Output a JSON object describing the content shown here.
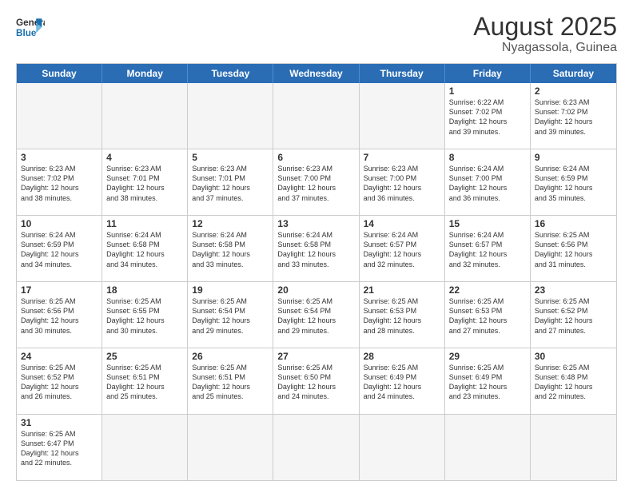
{
  "header": {
    "logo_general": "General",
    "logo_blue": "Blue",
    "month_year": "August 2025",
    "location": "Nyagassola, Guinea"
  },
  "days_of_week": [
    "Sunday",
    "Monday",
    "Tuesday",
    "Wednesday",
    "Thursday",
    "Friday",
    "Saturday"
  ],
  "weeks": [
    [
      {
        "day": "",
        "info": ""
      },
      {
        "day": "",
        "info": ""
      },
      {
        "day": "",
        "info": ""
      },
      {
        "day": "",
        "info": ""
      },
      {
        "day": "",
        "info": ""
      },
      {
        "day": "1",
        "info": "Sunrise: 6:22 AM\nSunset: 7:02 PM\nDaylight: 12 hours\nand 39 minutes."
      },
      {
        "day": "2",
        "info": "Sunrise: 6:23 AM\nSunset: 7:02 PM\nDaylight: 12 hours\nand 39 minutes."
      }
    ],
    [
      {
        "day": "3",
        "info": "Sunrise: 6:23 AM\nSunset: 7:02 PM\nDaylight: 12 hours\nand 38 minutes."
      },
      {
        "day": "4",
        "info": "Sunrise: 6:23 AM\nSunset: 7:01 PM\nDaylight: 12 hours\nand 38 minutes."
      },
      {
        "day": "5",
        "info": "Sunrise: 6:23 AM\nSunset: 7:01 PM\nDaylight: 12 hours\nand 37 minutes."
      },
      {
        "day": "6",
        "info": "Sunrise: 6:23 AM\nSunset: 7:00 PM\nDaylight: 12 hours\nand 37 minutes."
      },
      {
        "day": "7",
        "info": "Sunrise: 6:23 AM\nSunset: 7:00 PM\nDaylight: 12 hours\nand 36 minutes."
      },
      {
        "day": "8",
        "info": "Sunrise: 6:24 AM\nSunset: 7:00 PM\nDaylight: 12 hours\nand 36 minutes."
      },
      {
        "day": "9",
        "info": "Sunrise: 6:24 AM\nSunset: 6:59 PM\nDaylight: 12 hours\nand 35 minutes."
      }
    ],
    [
      {
        "day": "10",
        "info": "Sunrise: 6:24 AM\nSunset: 6:59 PM\nDaylight: 12 hours\nand 34 minutes."
      },
      {
        "day": "11",
        "info": "Sunrise: 6:24 AM\nSunset: 6:58 PM\nDaylight: 12 hours\nand 34 minutes."
      },
      {
        "day": "12",
        "info": "Sunrise: 6:24 AM\nSunset: 6:58 PM\nDaylight: 12 hours\nand 33 minutes."
      },
      {
        "day": "13",
        "info": "Sunrise: 6:24 AM\nSunset: 6:58 PM\nDaylight: 12 hours\nand 33 minutes."
      },
      {
        "day": "14",
        "info": "Sunrise: 6:24 AM\nSunset: 6:57 PM\nDaylight: 12 hours\nand 32 minutes."
      },
      {
        "day": "15",
        "info": "Sunrise: 6:24 AM\nSunset: 6:57 PM\nDaylight: 12 hours\nand 32 minutes."
      },
      {
        "day": "16",
        "info": "Sunrise: 6:25 AM\nSunset: 6:56 PM\nDaylight: 12 hours\nand 31 minutes."
      }
    ],
    [
      {
        "day": "17",
        "info": "Sunrise: 6:25 AM\nSunset: 6:56 PM\nDaylight: 12 hours\nand 30 minutes."
      },
      {
        "day": "18",
        "info": "Sunrise: 6:25 AM\nSunset: 6:55 PM\nDaylight: 12 hours\nand 30 minutes."
      },
      {
        "day": "19",
        "info": "Sunrise: 6:25 AM\nSunset: 6:54 PM\nDaylight: 12 hours\nand 29 minutes."
      },
      {
        "day": "20",
        "info": "Sunrise: 6:25 AM\nSunset: 6:54 PM\nDaylight: 12 hours\nand 29 minutes."
      },
      {
        "day": "21",
        "info": "Sunrise: 6:25 AM\nSunset: 6:53 PM\nDaylight: 12 hours\nand 28 minutes."
      },
      {
        "day": "22",
        "info": "Sunrise: 6:25 AM\nSunset: 6:53 PM\nDaylight: 12 hours\nand 27 minutes."
      },
      {
        "day": "23",
        "info": "Sunrise: 6:25 AM\nSunset: 6:52 PM\nDaylight: 12 hours\nand 27 minutes."
      }
    ],
    [
      {
        "day": "24",
        "info": "Sunrise: 6:25 AM\nSunset: 6:52 PM\nDaylight: 12 hours\nand 26 minutes."
      },
      {
        "day": "25",
        "info": "Sunrise: 6:25 AM\nSunset: 6:51 PM\nDaylight: 12 hours\nand 25 minutes."
      },
      {
        "day": "26",
        "info": "Sunrise: 6:25 AM\nSunset: 6:51 PM\nDaylight: 12 hours\nand 25 minutes."
      },
      {
        "day": "27",
        "info": "Sunrise: 6:25 AM\nSunset: 6:50 PM\nDaylight: 12 hours\nand 24 minutes."
      },
      {
        "day": "28",
        "info": "Sunrise: 6:25 AM\nSunset: 6:49 PM\nDaylight: 12 hours\nand 24 minutes."
      },
      {
        "day": "29",
        "info": "Sunrise: 6:25 AM\nSunset: 6:49 PM\nDaylight: 12 hours\nand 23 minutes."
      },
      {
        "day": "30",
        "info": "Sunrise: 6:25 AM\nSunset: 6:48 PM\nDaylight: 12 hours\nand 22 minutes."
      }
    ],
    [
      {
        "day": "31",
        "info": "Sunrise: 6:25 AM\nSunset: 6:47 PM\nDaylight: 12 hours\nand 22 minutes."
      },
      {
        "day": "",
        "info": ""
      },
      {
        "day": "",
        "info": ""
      },
      {
        "day": "",
        "info": ""
      },
      {
        "day": "",
        "info": ""
      },
      {
        "day": "",
        "info": ""
      },
      {
        "day": "",
        "info": ""
      }
    ]
  ]
}
